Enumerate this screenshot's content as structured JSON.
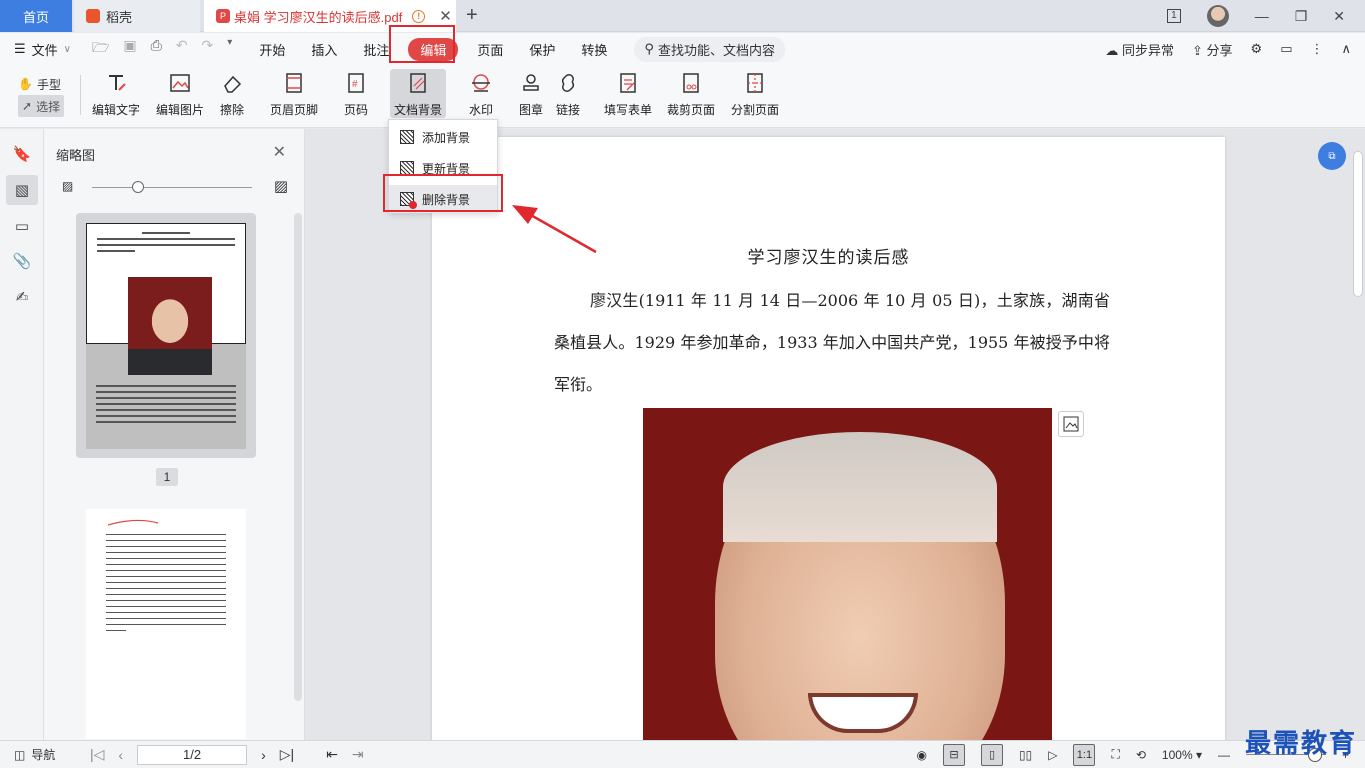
{
  "tabs": {
    "home": "首页",
    "daoke": "稻壳",
    "document": "桌娟 学习廖汉生的读后感.pdf"
  },
  "window": {
    "page_badge": "1"
  },
  "menu": {
    "file": "文件",
    "items": [
      "开始",
      "插入",
      "批注",
      "编辑",
      "页面",
      "保护",
      "转换"
    ],
    "active": "编辑",
    "search_placeholder": "查找功能、文档内容",
    "sync": "同步异常",
    "share": "分享"
  },
  "toolbar": {
    "hand": "手型",
    "select": "选择",
    "tools": [
      "编辑文字",
      "编辑图片",
      "擦除",
      "页眉页脚",
      "页码",
      "文档背景",
      "水印",
      "图章",
      "链接",
      "填写表单",
      "裁剪页面",
      "分割页面"
    ]
  },
  "bg_menu": {
    "items": [
      "添加背景",
      "更新背景",
      "删除背景"
    ]
  },
  "thumbnail_panel": {
    "title": "缩略图",
    "page_label": "1"
  },
  "document": {
    "title": "学习廖汉生的读后感",
    "paragraph": "廖汉生(1911 年 11 月 14 日—2006 年 10 月 05 日)，土家族，湖南省桑植县人。1929 年参加革命，1933 年加入中国共产党，1955 年被授予中将军衔。"
  },
  "statusbar": {
    "nav": "导航",
    "page_value": "1/2",
    "zoom": "100%",
    "actual_size": "1:1"
  },
  "watermark": "最需教育",
  "colors": {
    "accent": "#3d7ee0",
    "active_tab": "#e04848",
    "highlight": "#e0282e"
  }
}
